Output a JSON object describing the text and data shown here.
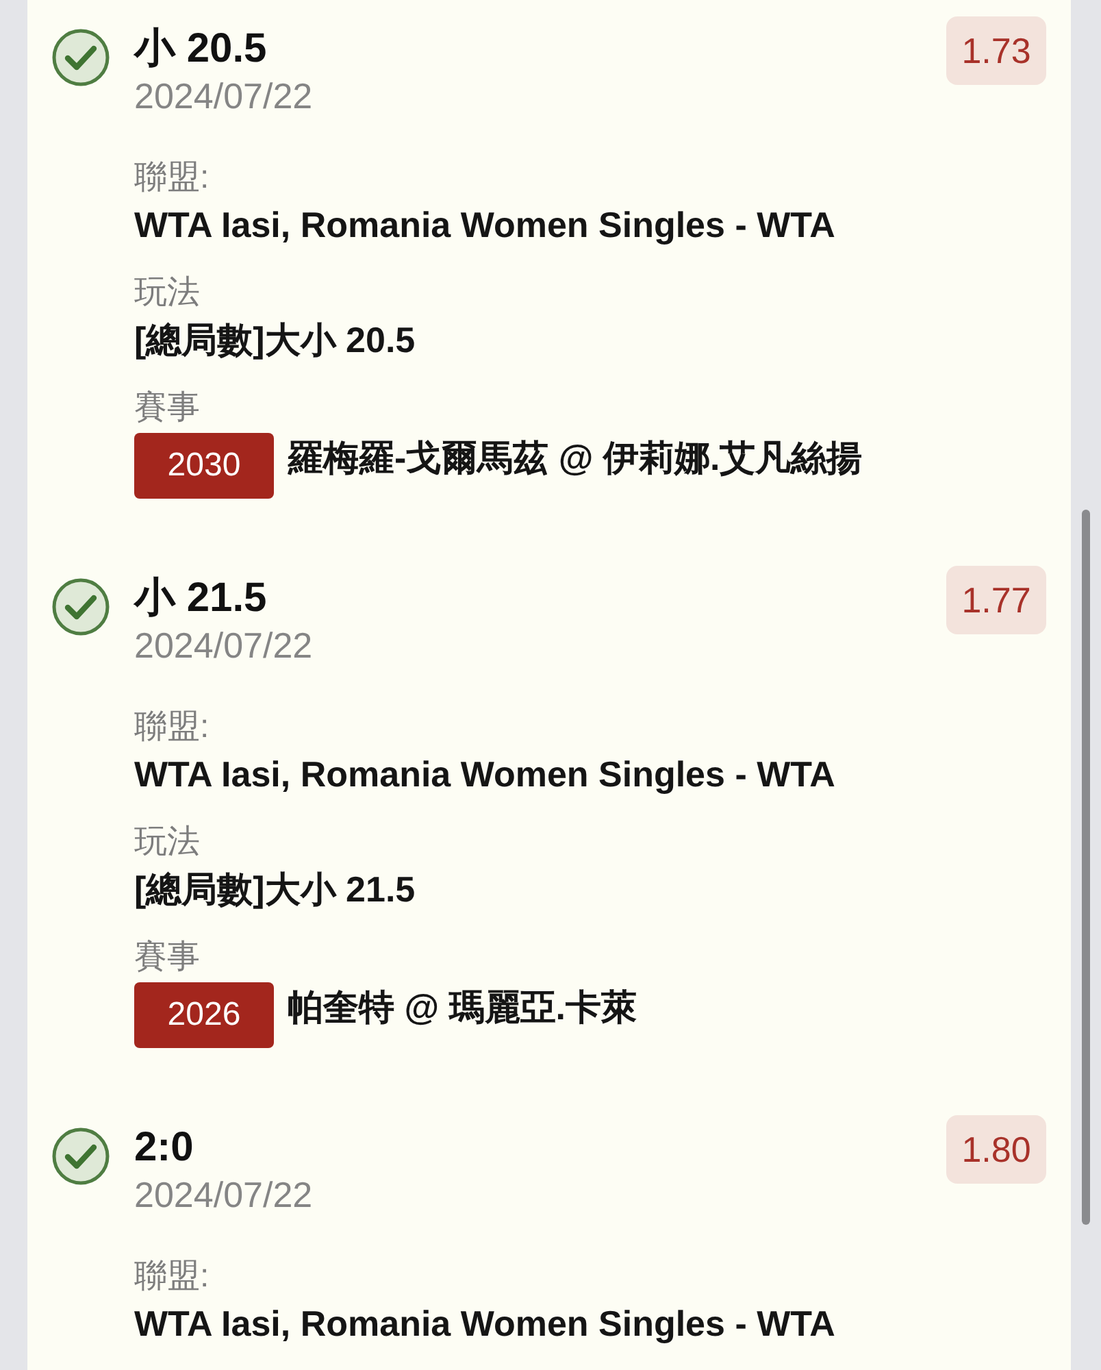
{
  "bets": [
    {
      "won": true,
      "selection": "小 20.5",
      "date": "2024/07/22",
      "odds": "1.73",
      "details": [
        {
          "kind": "text",
          "label": "聯盟:",
          "value": "WTA Iasi, Romania Women Singles - WTA"
        },
        {
          "kind": "text",
          "label": "玩法",
          "value": "[總局數]大小 20.5"
        },
        {
          "kind": "event",
          "label": "賽事",
          "code": "2030",
          "value": "羅梅羅-戈爾馬茲 @ 伊莉娜.艾凡絲揚"
        }
      ]
    },
    {
      "won": true,
      "selection": "小 21.5",
      "date": "2024/07/22",
      "odds": "1.77",
      "details": [
        {
          "kind": "text",
          "label": "聯盟:",
          "value": "WTA Iasi, Romania Women Singles - WTA"
        },
        {
          "kind": "text",
          "label": "玩法",
          "value": "[總局數]大小 21.5"
        },
        {
          "kind": "event",
          "label": "賽事",
          "code": "2026",
          "value": "帕奎特 @ 瑪麗亞.卡萊"
        }
      ]
    },
    {
      "won": true,
      "selection": "2:0",
      "date": "2024/07/22",
      "odds": "1.80",
      "details": [
        {
          "kind": "text",
          "label": "聯盟:",
          "value": "WTA Iasi, Romania Women Singles - WTA"
        }
      ]
    }
  ]
}
